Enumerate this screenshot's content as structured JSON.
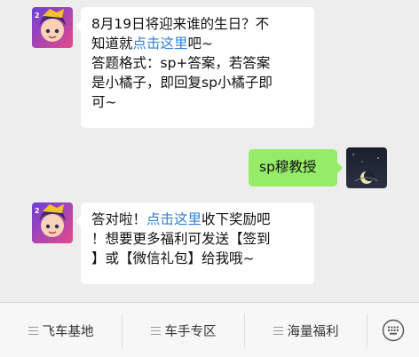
{
  "messages": [
    {
      "from": "bot",
      "lines": [
        {
          "pre": "8月19日将迎来谁的生日？不",
          "link": "",
          "post": ""
        },
        {
          "pre": "知道就",
          "link": "点击这里",
          "post": "吧~"
        },
        {
          "pre": "答题格式：sp+答案，若答案",
          "link": "",
          "post": ""
        },
        {
          "pre": "是小橘子，即回复sp小橘子即",
          "link": "",
          "post": ""
        },
        {
          "pre": "可~",
          "link": "",
          "post": ""
        }
      ]
    },
    {
      "from": "user",
      "text": "sp穆教授"
    },
    {
      "from": "bot",
      "lines": [
        {
          "pre": "答对啦！",
          "link": "点击这里",
          "post": "收下奖励吧"
        },
        {
          "pre": "！想要更多福利可发送【签到",
          "link": "",
          "post": ""
        },
        {
          "pre": "】或【微信礼包】给我哦~",
          "link": "",
          "post": ""
        }
      ]
    }
  ],
  "menu": [
    {
      "label": "飞车基地"
    },
    {
      "label": "车手专区"
    },
    {
      "label": "海量福利"
    }
  ],
  "colors": {
    "background": "#ededed",
    "bubble_user": "#95ec69",
    "bubble_bot": "#ffffff",
    "link": "#2f7fd8"
  },
  "icons": {
    "bot_avatar": "bot-avatar-icon",
    "user_avatar": "moon-night-avatar-icon",
    "keyboard": "keyboard-icon",
    "menu": "hamburger-icon"
  }
}
